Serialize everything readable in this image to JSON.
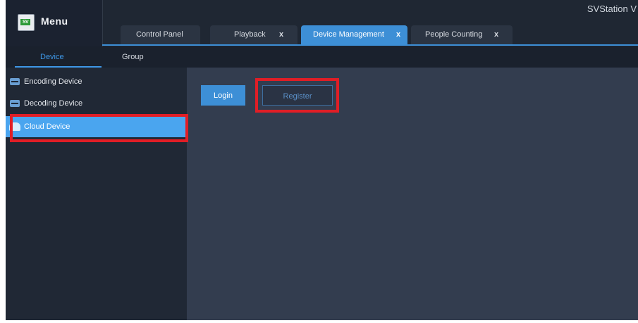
{
  "app": {
    "menu_label": "Menu",
    "logo_text": "SV",
    "brand": "SVStation V"
  },
  "tabs": [
    {
      "label": "Control Panel",
      "closable": false,
      "active": false
    },
    {
      "label": "Playback",
      "closable": true,
      "active": false
    },
    {
      "label": "Device Management",
      "closable": true,
      "active": true
    },
    {
      "label": "People Counting",
      "closable": true,
      "active": false
    }
  ],
  "tab_close_glyph": "x",
  "subtabs": [
    {
      "label": "Device",
      "active": true
    },
    {
      "label": "Group",
      "active": false
    }
  ],
  "sidebar": {
    "items": [
      {
        "label": "Encoding Device",
        "icon": "encoding-device-icon",
        "selected": false
      },
      {
        "label": "Decoding Device",
        "icon": "decoding-device-icon",
        "selected": false
      },
      {
        "label": "Cloud Device",
        "icon": "cloud-device-icon",
        "selected": true
      }
    ]
  },
  "main": {
    "login_label": "Login",
    "register_label": "Register"
  },
  "colors": {
    "accent": "#3d8fd6",
    "selected": "#4aa5ef",
    "highlight": "#e01e26",
    "background": "#333d4f"
  }
}
